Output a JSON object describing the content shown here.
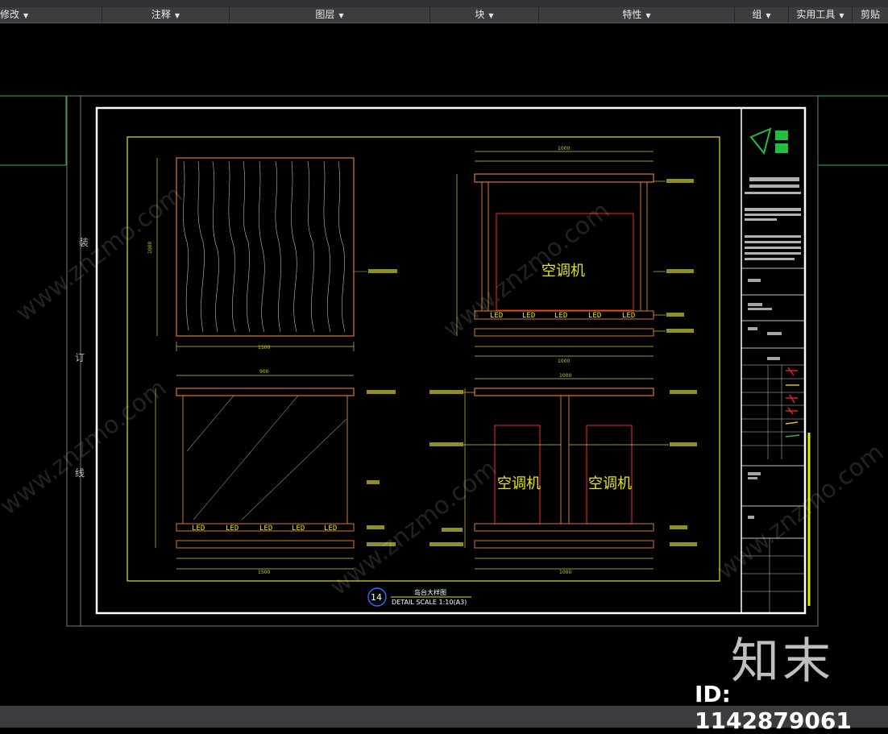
{
  "ribbon": {
    "tabs": [
      {
        "label": "修改"
      },
      {
        "label": "注释"
      },
      {
        "label": "图层"
      },
      {
        "label": "块"
      },
      {
        "label": "特性"
      },
      {
        "label": "组"
      },
      {
        "label": "实用工具"
      },
      {
        "label": "剪贴"
      }
    ]
  },
  "drawing": {
    "binding_chars": [
      "装",
      "订",
      "线"
    ],
    "ac_label": "空调机",
    "led": "LED",
    "title": {
      "number": "14",
      "name": "岛台大样图",
      "scale": "DETAIL SCALE 1:10(A3)"
    },
    "dims": {
      "top_front_width": "1500",
      "top_front_height": "1000",
      "side_width": "1000",
      "side_inner": "900"
    }
  },
  "watermark": {
    "site": "www.znzmo.com",
    "brand": "知末",
    "id": "ID: 1142879061"
  },
  "colors": {
    "canvas": "#000000",
    "frame_white": "#ffffff",
    "frame_yellow": "#e6e600",
    "drawing_orange": "#d9782a",
    "red": "#d02020",
    "green": "#22c03a",
    "dim_yellow": "#cccc33"
  }
}
